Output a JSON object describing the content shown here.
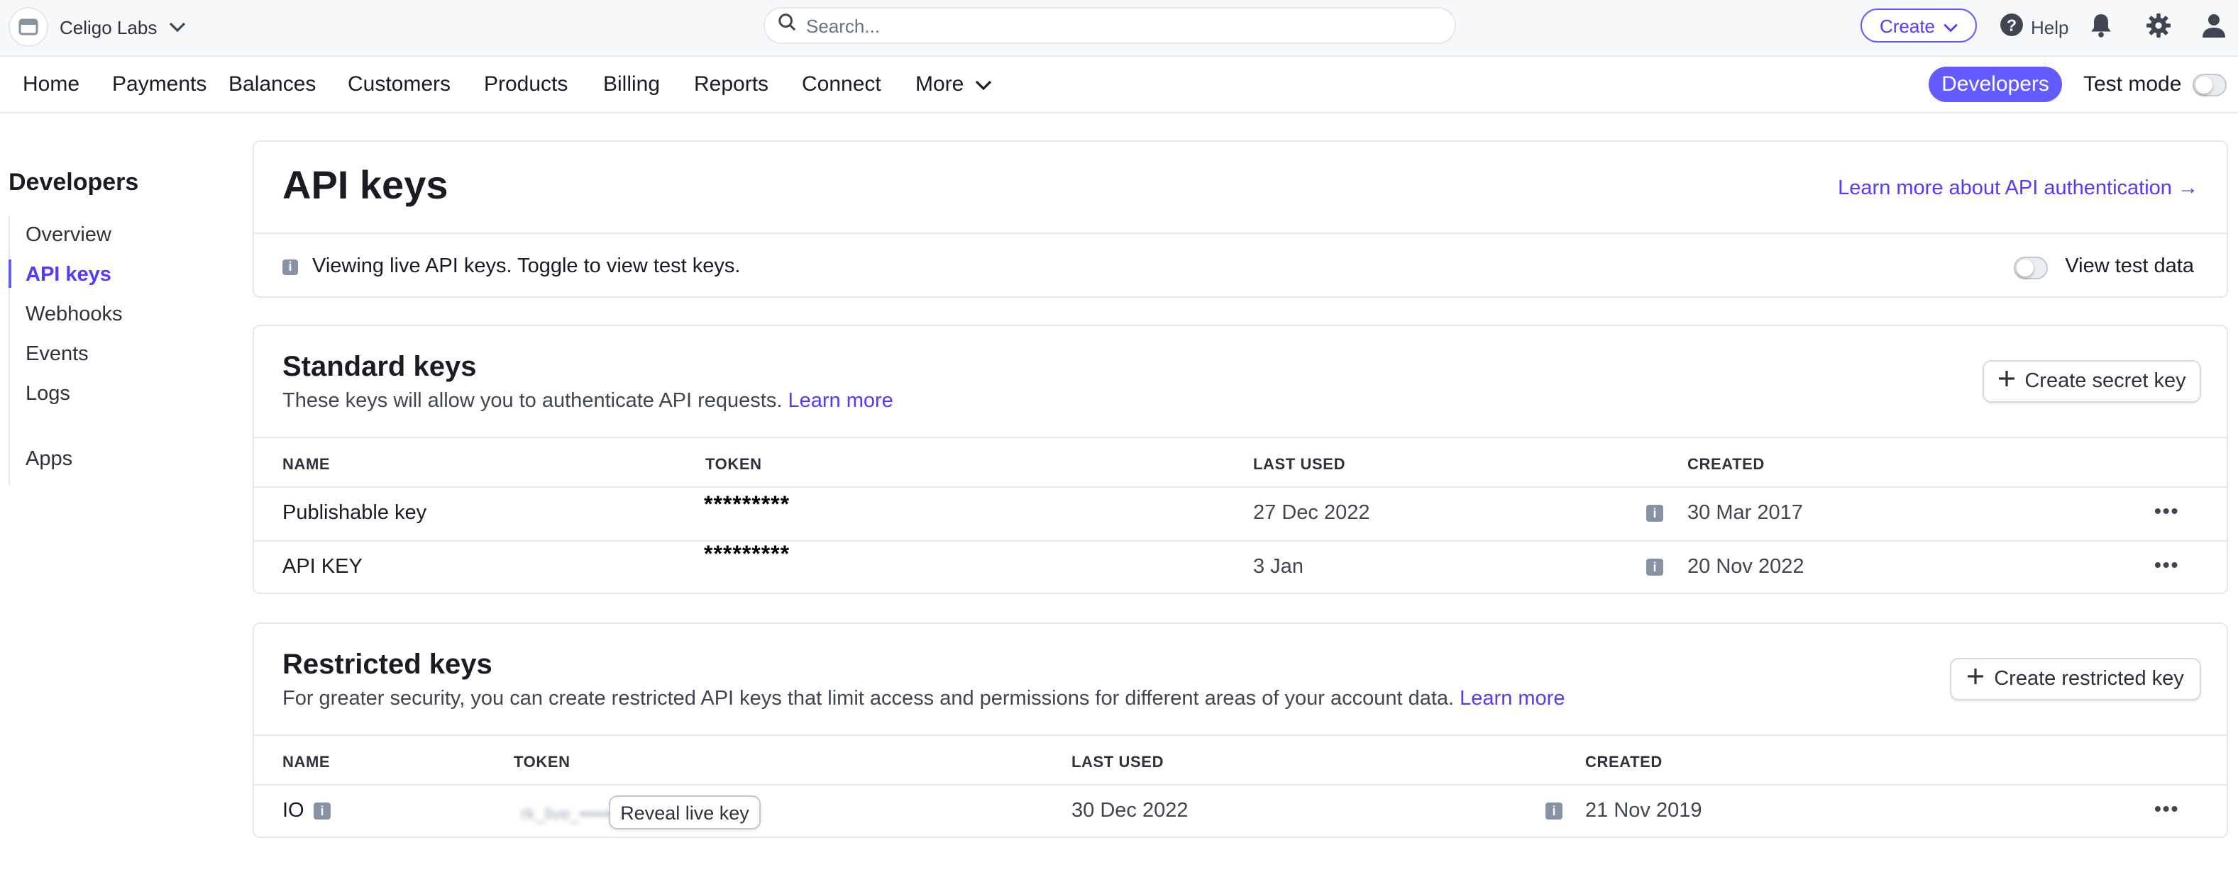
{
  "topbar": {
    "account_name": "Celigo Labs",
    "search_placeholder": "Search...",
    "create_label": "Create",
    "help_label": "Help"
  },
  "nav": {
    "items": [
      "Home",
      "Payments",
      "Balances",
      "Customers",
      "Products",
      "Billing",
      "Reports",
      "Connect",
      "More"
    ],
    "developers_label": "Developers",
    "test_mode_label": "Test mode"
  },
  "sidebar": {
    "title": "Developers",
    "items": [
      "Overview",
      "API keys",
      "Webhooks",
      "Events",
      "Logs"
    ],
    "extra_item": "Apps",
    "active": "API keys"
  },
  "page": {
    "title": "API keys",
    "learn_more_auth": "Learn more about API authentication →",
    "info_text": "Viewing live API keys. Toggle to view test keys.",
    "view_test_data_label": "View test data"
  },
  "standard_keys": {
    "title": "Standard keys",
    "description": "These keys will allow you to authenticate API requests.",
    "learn_more": "Learn more",
    "create_button": "Create secret key",
    "headers": [
      "NAME",
      "TOKEN",
      "LAST USED",
      "CREATED"
    ],
    "rows": [
      {
        "name": "Publishable key",
        "token": "*********",
        "last_used": "27 Dec 2022",
        "created": "30 Mar 2017"
      },
      {
        "name": "API KEY",
        "token": "*********",
        "last_used": "3 Jan",
        "created": "20 Nov 2022"
      }
    ]
  },
  "restricted_keys": {
    "title": "Restricted keys",
    "description": "For greater security, you can create restricted API keys that limit access and permissions for different areas of your account data.",
    "learn_more": "Learn more",
    "create_button": "Create restricted key",
    "headers": [
      "NAME",
      "TOKEN",
      "LAST USED",
      "CREATED"
    ],
    "rows": [
      {
        "name": "IO",
        "token_blurred": "rk_live_•••••••••••••••••••2b0f8ee",
        "reveal_label": "Reveal live key",
        "last_used": "30 Dec 2022",
        "created": "21 Nov 2019"
      }
    ]
  },
  "colors": {
    "accent": "#635bff",
    "link": "#533afd",
    "border": "#e3e8ee"
  }
}
